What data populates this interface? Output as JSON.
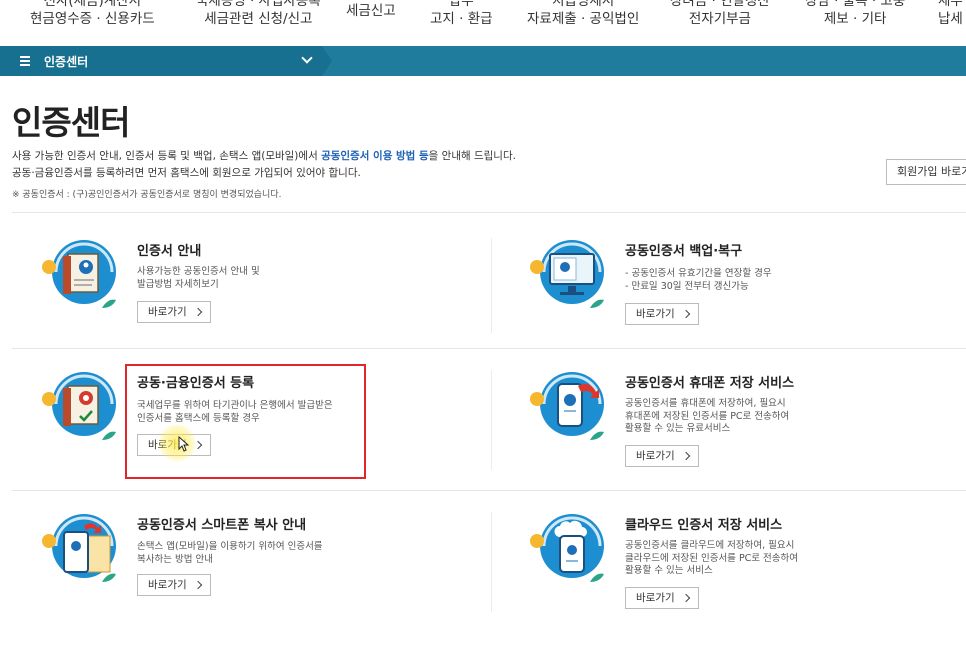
{
  "topnav": {
    "items": [
      {
        "line1": "전자(세금)계산서",
        "line2": "현금영수증 · 신용카드"
      },
      {
        "line1": "국세증명 · 사업자등록",
        "line2": "세금관련 신청/신고"
      },
      {
        "line1": "세금신고",
        "line2": ""
      },
      {
        "line1": "납부",
        "line2": "고지 · 환급"
      },
      {
        "line1": "지급명세서",
        "line2": "자료제출 · 공익법인"
      },
      {
        "line1": "장려금 · 연말정산",
        "line2": "전자기부금"
      },
      {
        "line1": "상담 · 불복 · 고충",
        "line2": "제보 · 기타"
      },
      {
        "line1": "세무",
        "line2": "납세"
      }
    ]
  },
  "bar": {
    "menu_label": "인증센터"
  },
  "page": {
    "title": "인증센터",
    "desc1_pre": "사용 가능한 인증서 안내, 인증서 등록 및 백업, 손택스 앱(모바일)에서 ",
    "desc1_hl": "공동인증서 이용 방법 등",
    "desc1_post": "을 안내해 드립니다.",
    "desc2": "공동·금융인증서를 등록하려면 먼저 홈택스에 회원으로 가입되어 있어야 합니다.",
    "note": "※ 공동인증서 : (구)공인인증서가 공동인증서로 명칭이 변경되었습니다.",
    "signup_button": "회원가입 바로가기"
  },
  "cards": [
    {
      "title": "인증서 안내",
      "desc": [
        "사용가능한 공동인증서 안내 및",
        "발급방법 자세히보기"
      ],
      "button": "바로가기"
    },
    {
      "title": "공동인증서 백업·복구",
      "desc": [
        "- 공동인증서 유효기간을 연장할 경우",
        "- 만료일 30일 전부터 갱신가능"
      ],
      "button": "바로가기"
    },
    {
      "title": "공동·금융인증서 등록",
      "desc": [
        "국세업무를 위하여 타기관이나 은행에서 발급받은",
        "인증서를 홈택스에 등록할 경우"
      ],
      "button": "바로가기"
    },
    {
      "title": "공동인증서 휴대폰 저장 서비스",
      "desc": [
        "공동인증서를 휴대폰에 저장하여, 필요시",
        "휴대폰에 저장된 인증서를 PC로 전송하여",
        "활용할 수 있는 유료서비스"
      ],
      "button": "바로가기"
    },
    {
      "title": "공동인증서 스마트폰 복사 안내",
      "desc": [
        "손택스 앱(모바일)을 이용하기 위하여 인증서를",
        "복사하는 방법 안내"
      ],
      "button": "바로가기"
    },
    {
      "title": "클라우드 인증서 저장 서비스",
      "desc": [
        "공동인증서를 클라우드에 저장하여, 필요시",
        "클라우드에 저장된 인증서를 PC로 전송하여",
        "활용할 수 있는 서비스"
      ],
      "button": "바로가기"
    }
  ],
  "icons": [
    "certificate-guide-icon",
    "certificate-backup-monitor-icon",
    "certificate-register-icon",
    "phone-storage-icon",
    "smartphone-copy-icon",
    "cloud-storage-icon"
  ],
  "colors": {
    "bar": "#1f7c9c",
    "accent_blue": "#1e62b6",
    "highlight_red": "#e0252b",
    "icon_circle": "#1d8fd0",
    "icon_yellow": "#f5b730",
    "icon_teal": "#2aa58a"
  }
}
